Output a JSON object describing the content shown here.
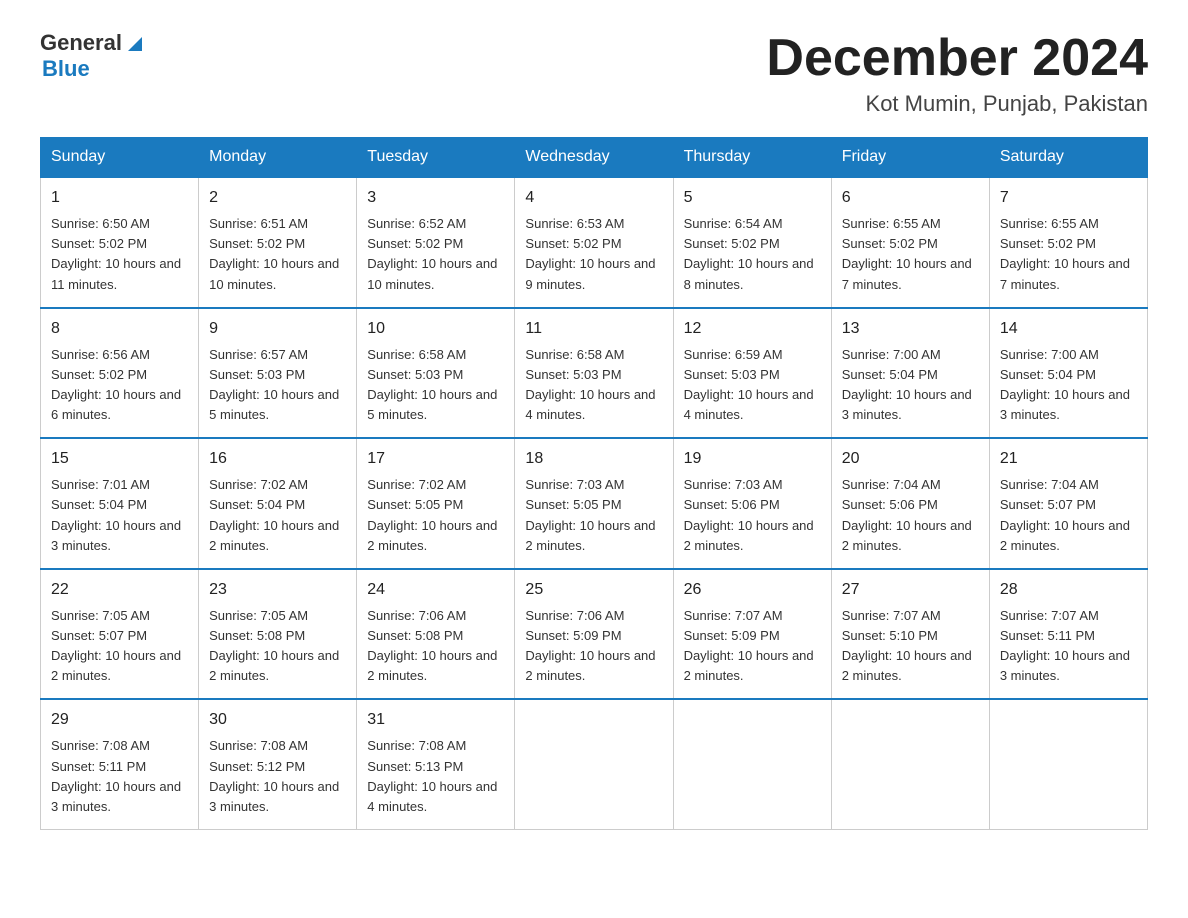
{
  "header": {
    "logo_general": "General",
    "logo_blue": "Blue",
    "month_year": "December 2024",
    "location": "Kot Mumin, Punjab, Pakistan"
  },
  "weekdays": [
    "Sunday",
    "Monday",
    "Tuesday",
    "Wednesday",
    "Thursday",
    "Friday",
    "Saturday"
  ],
  "weeks": [
    [
      {
        "day": "1",
        "sunrise": "6:50 AM",
        "sunset": "5:02 PM",
        "daylight": "10 hours and 11 minutes."
      },
      {
        "day": "2",
        "sunrise": "6:51 AM",
        "sunset": "5:02 PM",
        "daylight": "10 hours and 10 minutes."
      },
      {
        "day": "3",
        "sunrise": "6:52 AM",
        "sunset": "5:02 PM",
        "daylight": "10 hours and 10 minutes."
      },
      {
        "day": "4",
        "sunrise": "6:53 AM",
        "sunset": "5:02 PM",
        "daylight": "10 hours and 9 minutes."
      },
      {
        "day": "5",
        "sunrise": "6:54 AM",
        "sunset": "5:02 PM",
        "daylight": "10 hours and 8 minutes."
      },
      {
        "day": "6",
        "sunrise": "6:55 AM",
        "sunset": "5:02 PM",
        "daylight": "10 hours and 7 minutes."
      },
      {
        "day": "7",
        "sunrise": "6:55 AM",
        "sunset": "5:02 PM",
        "daylight": "10 hours and 7 minutes."
      }
    ],
    [
      {
        "day": "8",
        "sunrise": "6:56 AM",
        "sunset": "5:02 PM",
        "daylight": "10 hours and 6 minutes."
      },
      {
        "day": "9",
        "sunrise": "6:57 AM",
        "sunset": "5:03 PM",
        "daylight": "10 hours and 5 minutes."
      },
      {
        "day": "10",
        "sunrise": "6:58 AM",
        "sunset": "5:03 PM",
        "daylight": "10 hours and 5 minutes."
      },
      {
        "day": "11",
        "sunrise": "6:58 AM",
        "sunset": "5:03 PM",
        "daylight": "10 hours and 4 minutes."
      },
      {
        "day": "12",
        "sunrise": "6:59 AM",
        "sunset": "5:03 PM",
        "daylight": "10 hours and 4 minutes."
      },
      {
        "day": "13",
        "sunrise": "7:00 AM",
        "sunset": "5:04 PM",
        "daylight": "10 hours and 3 minutes."
      },
      {
        "day": "14",
        "sunrise": "7:00 AM",
        "sunset": "5:04 PM",
        "daylight": "10 hours and 3 minutes."
      }
    ],
    [
      {
        "day": "15",
        "sunrise": "7:01 AM",
        "sunset": "5:04 PM",
        "daylight": "10 hours and 3 minutes."
      },
      {
        "day": "16",
        "sunrise": "7:02 AM",
        "sunset": "5:04 PM",
        "daylight": "10 hours and 2 minutes."
      },
      {
        "day": "17",
        "sunrise": "7:02 AM",
        "sunset": "5:05 PM",
        "daylight": "10 hours and 2 minutes."
      },
      {
        "day": "18",
        "sunrise": "7:03 AM",
        "sunset": "5:05 PM",
        "daylight": "10 hours and 2 minutes."
      },
      {
        "day": "19",
        "sunrise": "7:03 AM",
        "sunset": "5:06 PM",
        "daylight": "10 hours and 2 minutes."
      },
      {
        "day": "20",
        "sunrise": "7:04 AM",
        "sunset": "5:06 PM",
        "daylight": "10 hours and 2 minutes."
      },
      {
        "day": "21",
        "sunrise": "7:04 AM",
        "sunset": "5:07 PM",
        "daylight": "10 hours and 2 minutes."
      }
    ],
    [
      {
        "day": "22",
        "sunrise": "7:05 AM",
        "sunset": "5:07 PM",
        "daylight": "10 hours and 2 minutes."
      },
      {
        "day": "23",
        "sunrise": "7:05 AM",
        "sunset": "5:08 PM",
        "daylight": "10 hours and 2 minutes."
      },
      {
        "day": "24",
        "sunrise": "7:06 AM",
        "sunset": "5:08 PM",
        "daylight": "10 hours and 2 minutes."
      },
      {
        "day": "25",
        "sunrise": "7:06 AM",
        "sunset": "5:09 PM",
        "daylight": "10 hours and 2 minutes."
      },
      {
        "day": "26",
        "sunrise": "7:07 AM",
        "sunset": "5:09 PM",
        "daylight": "10 hours and 2 minutes."
      },
      {
        "day": "27",
        "sunrise": "7:07 AM",
        "sunset": "5:10 PM",
        "daylight": "10 hours and 2 minutes."
      },
      {
        "day": "28",
        "sunrise": "7:07 AM",
        "sunset": "5:11 PM",
        "daylight": "10 hours and 3 minutes."
      }
    ],
    [
      {
        "day": "29",
        "sunrise": "7:08 AM",
        "sunset": "5:11 PM",
        "daylight": "10 hours and 3 minutes."
      },
      {
        "day": "30",
        "sunrise": "7:08 AM",
        "sunset": "5:12 PM",
        "daylight": "10 hours and 3 minutes."
      },
      {
        "day": "31",
        "sunrise": "7:08 AM",
        "sunset": "5:13 PM",
        "daylight": "10 hours and 4 minutes."
      },
      null,
      null,
      null,
      null
    ]
  ]
}
